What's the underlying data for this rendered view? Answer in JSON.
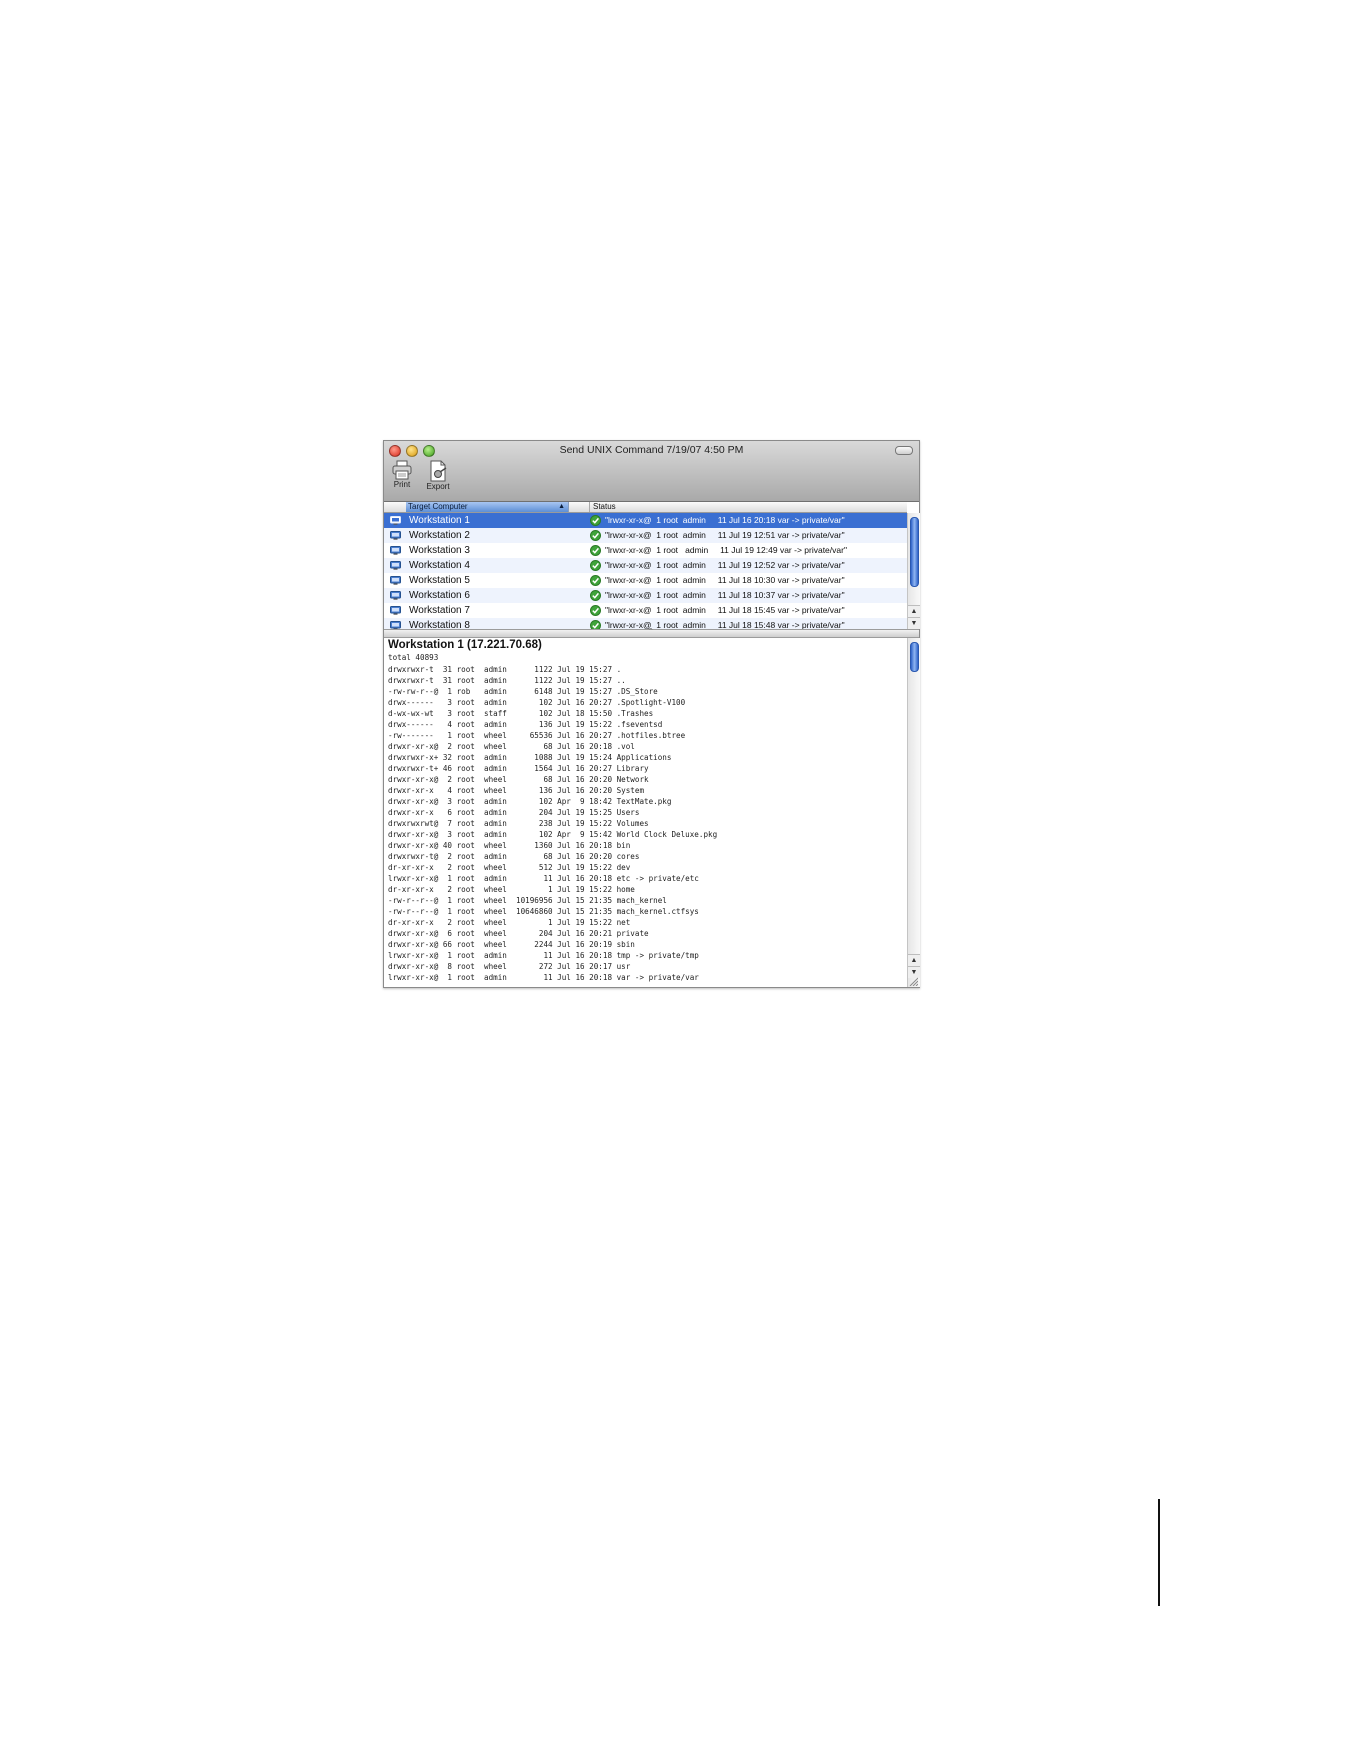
{
  "window": {
    "title": "Send UNIX Command  7/19/07 4:50 PM"
  },
  "toolbar": {
    "print_label": "Print",
    "export_label": "Export"
  },
  "list": {
    "columns": {
      "target": "Target Computer",
      "status": "Status"
    },
    "rows": [
      {
        "name": "Workstation 1",
        "status": "\"lrwxr-xr-x@  1 root  admin     11 Jul 16 20:18 var -> private/var\""
      },
      {
        "name": "Workstation 2",
        "status": "\"lrwxr-xr-x@  1 root  admin     11 Jul 19 12:51 var -> private/var\""
      },
      {
        "name": "Workstation 3",
        "status": "\"lrwxr-xr-x@  1 root   admin     11 Jul 19 12:49 var -> private/var\""
      },
      {
        "name": "Workstation 4",
        "status": "\"lrwxr-xr-x@  1 root  admin     11 Jul 19 12:52 var -> private/var\""
      },
      {
        "name": "Workstation 5",
        "status": "\"lrwxr-xr-x@  1 root  admin     11 Jul 18 10:30 var -> private/var\""
      },
      {
        "name": "Workstation 6",
        "status": "\"lrwxr-xr-x@  1 root  admin     11 Jul 18 10:37 var -> private/var\""
      },
      {
        "name": "Workstation 7",
        "status": "\"lrwxr-xr-x@  1 root  admin     11 Jul 18 15:45 var -> private/var\""
      },
      {
        "name": "Workstation 8",
        "status": "\"lrwxr-xr-x@  1 root  admin     11 Jul 18 15:48 var -> private/var\""
      }
    ]
  },
  "output": {
    "title": "Workstation 1 (17.221.70.68)",
    "total": "total 40893",
    "lines": [
      "drwxrwxr-t  31 root  admin      1122 Jul 19 15:27 .",
      "drwxrwxr-t  31 root  admin      1122 Jul 19 15:27 ..",
      "-rw-rw-r--@  1 rob   admin      6148 Jul 19 15:27 .DS_Store",
      "drwx------   3 root  admin       102 Jul 16 20:27 .Spotlight-V100",
      "d-wx-wx-wt   3 root  staff       102 Jul 18 15:50 .Trashes",
      "drwx------   4 root  admin       136 Jul 19 15:22 .fseventsd",
      "-rw-------   1 root  wheel     65536 Jul 16 20:27 .hotfiles.btree",
      "drwxr-xr-x@  2 root  wheel        68 Jul 16 20:18 .vol",
      "drwxrwxr-x+ 32 root  admin      1088 Jul 19 15:24 Applications",
      "drwxrwxr-t+ 46 root  admin      1564 Jul 16 20:27 Library",
      "drwxr-xr-x@  2 root  wheel        68 Jul 16 20:20 Network",
      "drwxr-xr-x   4 root  wheel       136 Jul 16 20:20 System",
      "drwxr-xr-x@  3 root  admin       102 Apr  9 18:42 TextMate.pkg",
      "drwxr-xr-x   6 root  admin       204 Jul 19 15:25 Users",
      "drwxrwxrwt@  7 root  admin       238 Jul 19 15:22 Volumes",
      "drwxr-xr-x@  3 root  admin       102 Apr  9 15:42 World Clock Deluxe.pkg",
      "drwxr-xr-x@ 40 root  wheel      1360 Jul 16 20:18 bin",
      "drwxrwxr-t@  2 root  admin        68 Jul 16 20:20 cores",
      "dr-xr-xr-x   2 root  wheel       512 Jul 19 15:22 dev",
      "lrwxr-xr-x@  1 root  admin        11 Jul 16 20:18 etc -> private/etc",
      "dr-xr-xr-x   2 root  wheel         1 Jul 19 15:22 home",
      "-rw-r--r--@  1 root  wheel  10196956 Jul 15 21:35 mach_kernel",
      "-rw-r--r--@  1 root  wheel  10646860 Jul 15 21:35 mach_kernel.ctfsys",
      "dr-xr-xr-x   2 root  wheel         1 Jul 19 15:22 net",
      "drwxr-xr-x@  6 root  wheel       204 Jul 16 20:21 private",
      "drwxr-xr-x@ 66 root  wheel      2244 Jul 16 20:19 sbin",
      "lrwxr-xr-x@  1 root  admin        11 Jul 16 20:18 tmp -> private/tmp",
      "drwxr-xr-x@  8 root  wheel       272 Jul 16 20:17 usr",
      "lrwxr-xr-x@  1 root  admin        11 Jul 16 20:18 var -> private/var"
    ]
  },
  "colors": {
    "selection": "#3a6fd2",
    "alt_row": "#eef3fd",
    "check": "#3fa33a"
  }
}
